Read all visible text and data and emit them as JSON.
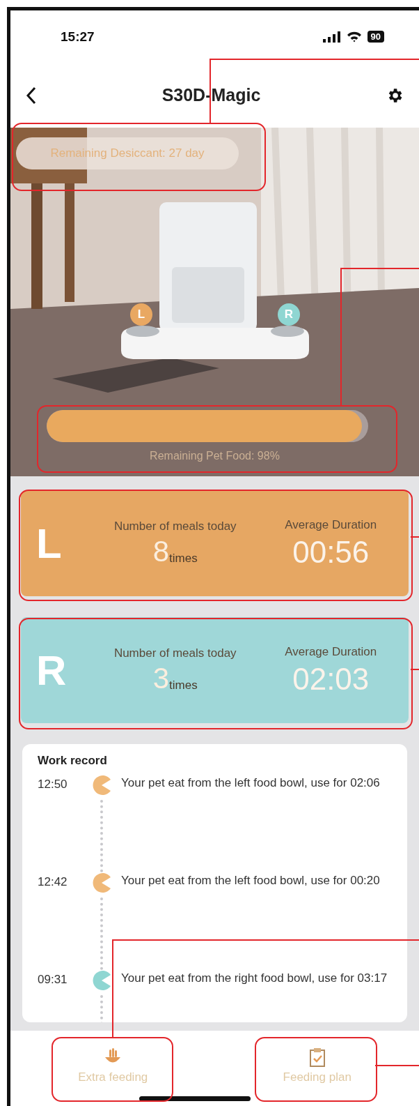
{
  "status_bar": {
    "time": "15:27",
    "battery": "90"
  },
  "nav": {
    "title": "S30D-Magic"
  },
  "device_photo": {
    "kind": "picture",
    "desiccant": "Remaining Desiccant: 27 day",
    "bowl_markers": [
      {
        "label": "L",
        "color": "#e9a862"
      },
      {
        "label": "R",
        "color": "#8fd6d2"
      }
    ],
    "food": {
      "level": 0.98,
      "label": "Remaining Pet Food: 98%"
    }
  },
  "sides": [
    {
      "side_label": "L",
      "meals_label": "Number of meals today",
      "count": "8",
      "unit": "times",
      "duration_label": "Average Duration",
      "duration": "00:56",
      "color": "#e6a763"
    },
    {
      "side_label": "R",
      "meals_label": "Number of meals today",
      "count": "3",
      "unit": "times",
      "duration_label": "Average Duration",
      "duration": "02:03",
      "color": "#9fd7d8"
    }
  ],
  "work_record": {
    "title": "Work record",
    "entries": [
      {
        "time": "12:50",
        "text": "Your pet eat from the left food bowl, use for 02:06",
        "color": "#f0b979"
      },
      {
        "time": "12:42",
        "text": "Your pet eat from the left food bowl, use for 00:20",
        "color": "#f0b979"
      },
      {
        "time": "09:31",
        "text": "Your pet eat from the right food bowl, use for 03:17",
        "color": "#8fd6d2"
      }
    ]
  },
  "bottom_actions": [
    {
      "label": "Extra feeding",
      "kind": "hand"
    },
    {
      "label": "Feeding plan",
      "kind": "clipboard"
    }
  ]
}
